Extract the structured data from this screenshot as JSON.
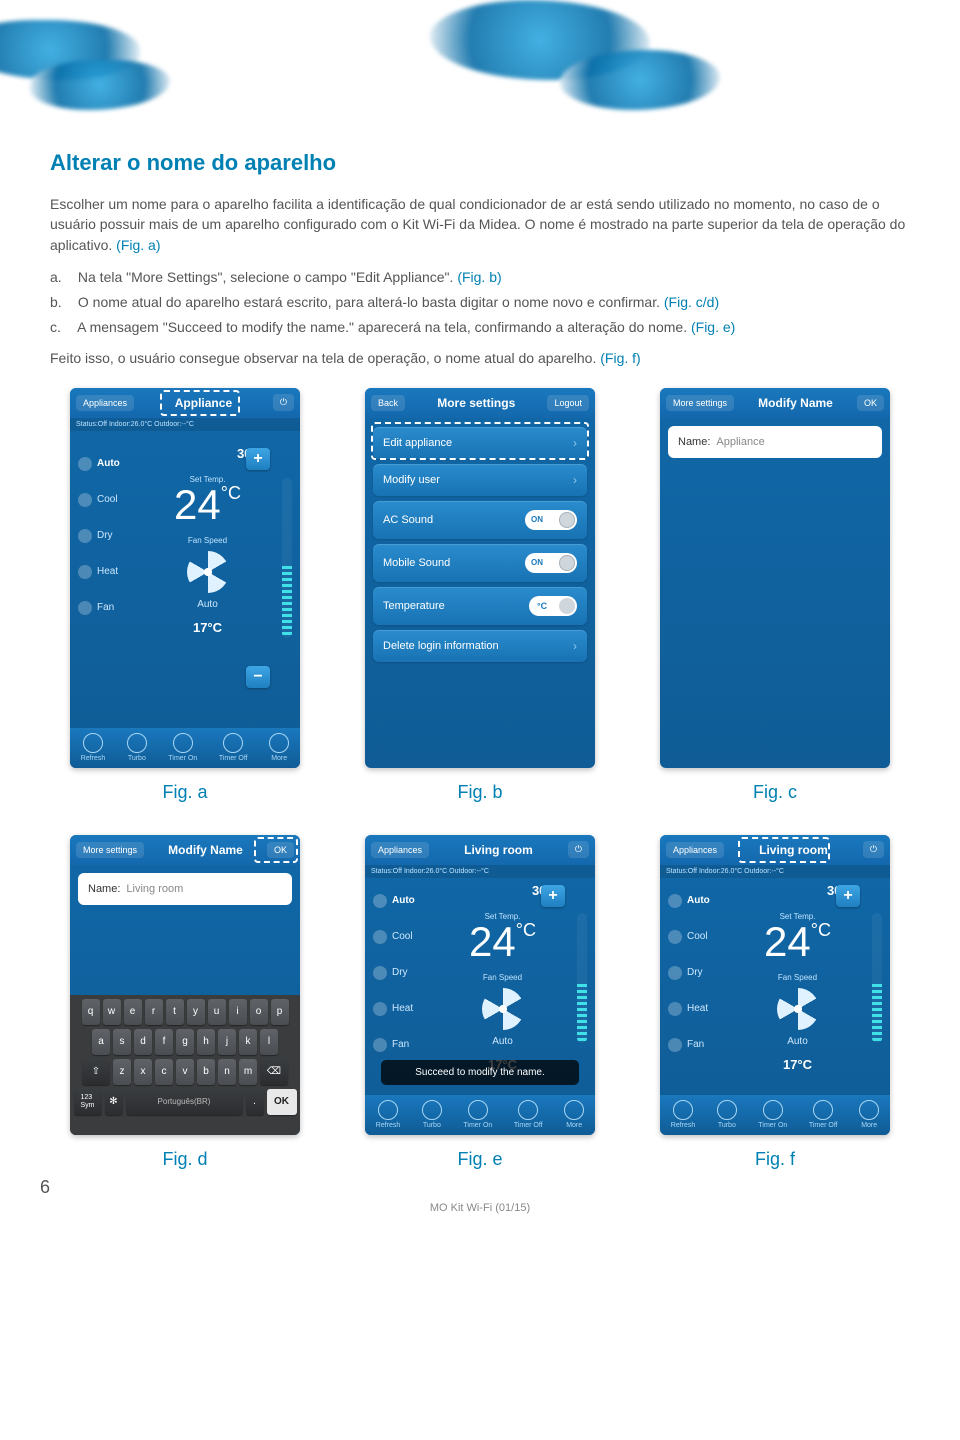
{
  "page_number": "6",
  "footer": "MO Kit Wi-Fi (01/15)",
  "title": "Alterar o nome do aparelho",
  "intro": "Escolher um nome para o aparelho facilita a identificação de qual condicionador de ar está sendo utilizado no momento, no caso de o usuário possuir mais de um aparelho configurado com o Kit Wi-Fi da Midea. O nome é mostrado na parte superior da tela de operação do aplicativo. ",
  "intro_figref": "(Fig. a)",
  "steps": [
    {
      "marker": "a.",
      "text": "Na tela \"More Settings\", selecione o campo \"Edit Appliance\". ",
      "figref": "(Fig. b)"
    },
    {
      "marker": "b.",
      "text": "O nome atual do aparelho estará escrito, para alterá-lo basta digitar o nome novo e confirmar. ",
      "figref": "(Fig. c/d)"
    },
    {
      "marker": "c.",
      "text": "A mensagem \"Succeed to modify the name.\" aparecerá na tela, confirmando a alteração do nome. ",
      "figref": "(Fig. e)"
    }
  ],
  "conclude": "Feito isso, o usuário consegue observar na tela de operação, o nome atual do aparelho. ",
  "conclude_figref": "(Fig. f)",
  "captions": {
    "a": "Fig. a",
    "b": "Fig. b",
    "c": "Fig. c",
    "d": "Fig. d",
    "e": "Fig. e",
    "f": "Fig. f"
  },
  "figA": {
    "topbar_left": "Appliances",
    "topbar_center": "Appliance",
    "status": "Status:Off Indoor:26.0°C Outdoor:--°C",
    "modes": [
      "Auto",
      "Cool",
      "Dry",
      "Heat",
      "Fan"
    ],
    "toptemp": "30°C",
    "settemp_label": "Set Temp.",
    "bigtemp": "24",
    "bigunit": "°C",
    "fanspeed_label": "Fan Speed",
    "autolabel": "Auto",
    "bottemp": "17°C",
    "bottom": [
      "Refresh",
      "Turbo",
      "Timer On",
      "Timer Off",
      "More"
    ]
  },
  "figB": {
    "topbar_left": "Back",
    "topbar_center": "More settings",
    "topbar_right": "Logout",
    "items": [
      {
        "label": "Edit appliance",
        "type": "arrow"
      },
      {
        "label": "Modify user",
        "type": "arrow"
      },
      {
        "label": "AC Sound",
        "type": "toggle",
        "value": "ON"
      },
      {
        "label": "Mobile Sound",
        "type": "toggle",
        "value": "ON"
      },
      {
        "label": "Temperature",
        "type": "temp",
        "value": "°C"
      },
      {
        "label": "Delete login information",
        "type": "arrow"
      }
    ]
  },
  "figC": {
    "topbar_left": "More settings",
    "topbar_center": "Modify Name",
    "topbar_right": "OK",
    "name_label": "Name:",
    "name_value": "Appliance"
  },
  "figD": {
    "topbar_left": "More settings",
    "topbar_center": "Modify Name",
    "topbar_right": "OK",
    "name_label": "Name:",
    "name_value": "Living room",
    "kb_rows": [
      [
        "q",
        "w",
        "e",
        "r",
        "t",
        "y",
        "u",
        "i",
        "o",
        "p"
      ],
      [
        "a",
        "s",
        "d",
        "f",
        "g",
        "h",
        "j",
        "k",
        "l"
      ],
      [
        "⇧",
        "z",
        "x",
        "c",
        "v",
        "b",
        "n",
        "m",
        "⌫"
      ]
    ],
    "kb_bottom_sym": "123\nSym",
    "kb_bottom_gear": "✻",
    "kb_bottom_space": "Português(BR)",
    "kb_bottom_dot": ".",
    "kb_bottom_ok": "OK"
  },
  "figE": {
    "topbar_left": "Appliances",
    "topbar_center": "Living room",
    "status": "Status:Off Indoor:26.0°C Outdoor:--°C",
    "modes": [
      "Auto",
      "Cool",
      "Dry",
      "Heat",
      "Fan"
    ],
    "toptemp": "30°C",
    "settemp_label": "Set Temp.",
    "bigtemp": "24",
    "bigunit": "°C",
    "fanspeed_label": "Fan Speed",
    "autolabel": "Auto",
    "bottemp": "17°C",
    "toast": "Succeed to modify the name.",
    "bottom": [
      "Refresh",
      "Turbo",
      "Timer On",
      "Timer Off",
      "More"
    ]
  },
  "figF": {
    "topbar_left": "Appliances",
    "topbar_center": "Living room",
    "status": "Status:Off Indoor:26.0°C Outdoor:--°C",
    "modes": [
      "Auto",
      "Cool",
      "Dry",
      "Heat",
      "Fan"
    ],
    "toptemp": "30°C",
    "settemp_label": "Set Temp.",
    "bigtemp": "24",
    "bigunit": "°C",
    "fanspeed_label": "Fan Speed",
    "autolabel": "Auto",
    "bottemp": "17°C",
    "bottom": [
      "Refresh",
      "Turbo",
      "Timer On",
      "Timer Off",
      "More"
    ]
  }
}
